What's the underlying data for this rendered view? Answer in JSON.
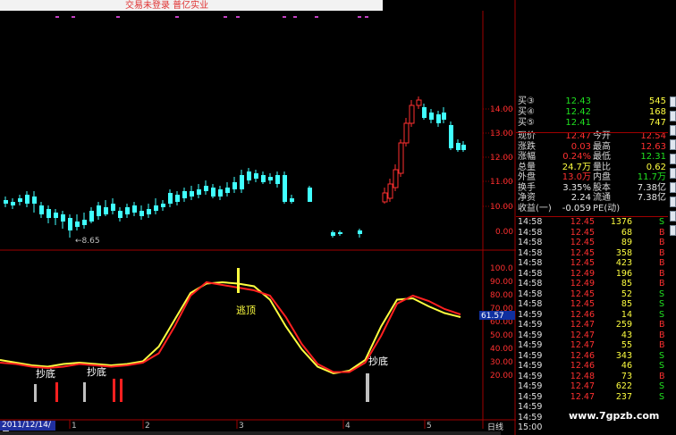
{
  "banner": {
    "text": "交易未登录  普亿实业"
  },
  "kline": {
    "price_axis": [
      "14.00",
      "13.00",
      "12.00",
      "11.00",
      "10.00",
      "0.00"
    ],
    "low_marker": "←8.65"
  },
  "indicator": {
    "axis": [
      "100.0",
      "90.00",
      "80.00",
      "70.00",
      "60.00",
      "50.00",
      "40.00",
      "30.00",
      "20.00"
    ],
    "current_value": "61.57",
    "signals": [
      "抄底",
      "抄底",
      "逃顶",
      "抄底"
    ]
  },
  "date_axis": {
    "current_date": "2011/12/14/三",
    "month_ticks": [
      "1",
      "2",
      "3",
      "4",
      "5"
    ],
    "period": "日线"
  },
  "quote": {
    "bids": [
      {
        "label": "买③",
        "price": "12.43",
        "vol": "545"
      },
      {
        "label": "买④",
        "price": "12.42",
        "vol": "168"
      },
      {
        "label": "买⑤",
        "price": "12.41",
        "vol": "747"
      }
    ],
    "stats": [
      {
        "l1": "现价",
        "v1": "12.47",
        "c1": "red",
        "l2": "今开",
        "v2": "12.54",
        "c2": "red"
      },
      {
        "l1": "涨跌",
        "v1": "0.03",
        "c1": "red",
        "l2": "最高",
        "v2": "12.63",
        "c2": "red"
      },
      {
        "l1": "涨幅",
        "v1": "0.24%",
        "c1": "red",
        "l2": "最低",
        "v2": "12.31",
        "c2": "green"
      },
      {
        "l1": "总量",
        "v1": "24.7万",
        "c1": "yellow",
        "l2": "量比",
        "v2": "0.62",
        "c2": "yellow"
      },
      {
        "l1": "外盘",
        "v1": "13.0万",
        "c1": "red",
        "l2": "内盘",
        "v2": "11.7万",
        "c2": "green"
      },
      {
        "l1": "换手",
        "v1": "3.35%",
        "c1": "white",
        "l2": "股本",
        "v2": "7.38亿",
        "c2": "white"
      },
      {
        "l1": "净资",
        "v1": "2.24",
        "c1": "white",
        "l2": "流通",
        "v2": "7.38亿",
        "c2": "white"
      },
      {
        "l1": "收益(一)",
        "v1": "-0.059",
        "c1": "white",
        "l2": "PE(动)",
        "v2": "",
        "c2": "white"
      }
    ],
    "ticks": [
      {
        "time": "14:58",
        "price": "12.45",
        "vol": "1376",
        "side": "S"
      },
      {
        "time": "14:58",
        "price": "12.45",
        "vol": "68",
        "side": "B"
      },
      {
        "time": "14:58",
        "price": "12.45",
        "vol": "89",
        "side": "B"
      },
      {
        "time": "14:58",
        "price": "12.45",
        "vol": "358",
        "side": "B"
      },
      {
        "time": "14:58",
        "price": "12.45",
        "vol": "423",
        "side": "B"
      },
      {
        "time": "14:58",
        "price": "12.49",
        "vol": "196",
        "side": "B"
      },
      {
        "time": "14:58",
        "price": "12.49",
        "vol": "85",
        "side": "B"
      },
      {
        "time": "14:58",
        "price": "12.45",
        "vol": "52",
        "side": "S"
      },
      {
        "time": "14:58",
        "price": "12.45",
        "vol": "85",
        "side": "S"
      },
      {
        "time": "14:59",
        "price": "12.46",
        "vol": "14",
        "side": "S"
      },
      {
        "time": "14:59",
        "price": "12.47",
        "vol": "259",
        "side": "B"
      },
      {
        "time": "14:59",
        "price": "12.47",
        "vol": "43",
        "side": "B"
      },
      {
        "time": "14:59",
        "price": "12.47",
        "vol": "55",
        "side": "B"
      },
      {
        "time": "14:59",
        "price": "12.46",
        "vol": "343",
        "side": "S"
      },
      {
        "time": "14:59",
        "price": "12.46",
        "vol": "46",
        "side": "S"
      },
      {
        "time": "14:59",
        "price": "12.48",
        "vol": "73",
        "side": "B"
      },
      {
        "time": "14:59",
        "price": "12.47",
        "vol": "622",
        "side": "S"
      },
      {
        "time": "14:59",
        "price": "12.47",
        "vol": "237",
        "side": "S"
      },
      {
        "time": "14:59",
        "price": "",
        "vol": "",
        "side": ""
      },
      {
        "time": "14:59",
        "price": "",
        "vol": "",
        "side": ""
      },
      {
        "time": "15:00",
        "price": "",
        "vol": "",
        "side": ""
      }
    ]
  },
  "watermark": "www.7gpzb.com",
  "colors": {
    "up": "#ff3030",
    "down": "#40ffff",
    "k_line": "#ffff40",
    "d_line": "#ff2020",
    "axis_red": "#a00000"
  },
  "chart_data": {
    "type": "line",
    "x": [
      1,
      2,
      3,
      4,
      5,
      6,
      7,
      8,
      9,
      10,
      11,
      12,
      13,
      14,
      15,
      16,
      17,
      18,
      19,
      20,
      21,
      22,
      23,
      24,
      25,
      26,
      27,
      28,
      29,
      30
    ],
    "series": [
      {
        "values": [
          30,
          28,
          26,
          25,
          27,
          28,
          27,
          26,
          27,
          29,
          40,
          60,
          80,
          87,
          88,
          87,
          85,
          75,
          55,
          38,
          25,
          20,
          22,
          30,
          55,
          75,
          76,
          70,
          65,
          62
        ]
      },
      {
        "values": [
          28,
          27,
          25,
          24,
          25,
          27,
          26,
          25,
          26,
          28,
          35,
          55,
          78,
          88,
          86,
          84,
          82,
          78,
          62,
          42,
          27,
          21,
          21,
          28,
          48,
          72,
          78,
          74,
          68,
          64
        ]
      }
    ],
    "ylim": [
      0,
      100
    ]
  }
}
